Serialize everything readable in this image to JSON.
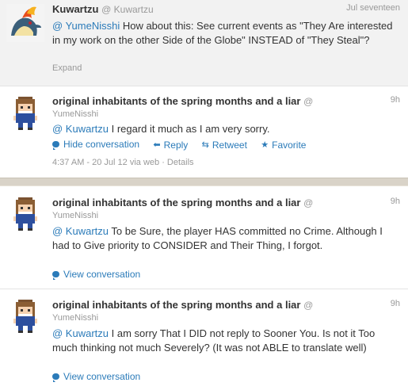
{
  "tweets": [
    {
      "name": "Kuwartzu",
      "handle": "@ Kuwartzu",
      "time": "Jul seventeen",
      "mention": "@ YumeNisshi",
      "text": " How about this: See current events as \"They Are interested in my work on the other Side of the Globe\" INSTEAD of \"They Steal\"?",
      "expand": "Expand"
    },
    {
      "name": "original inhabitants of the spring months and a liar",
      "handle_prefix": "@",
      "handle": "YumeNisshi",
      "time": "9h",
      "mention": "@ Kuwartzu",
      "text": " I regard it much as I am very sorry.",
      "actions": {
        "hide": "Hide conversation",
        "reply": "Reply",
        "retweet": "Retweet",
        "favorite": "Favorite"
      },
      "meta": "4:37 AM - 20 Jul 12 via web · Details"
    },
    {
      "name": "original inhabitants of the spring months and a liar",
      "handle_prefix": "@",
      "handle": "YumeNisshi",
      "time": "9h",
      "mention": "@ Kuwartzu",
      "text": " To be Sure, the player HAS committed no Crime. Although I had to Give priority to CONSIDER and Their Thing, I forgot.",
      "view": "View conversation"
    },
    {
      "name": "original inhabitants of the spring months and a liar",
      "handle_prefix": "@",
      "handle": "YumeNisshi",
      "time": "9h",
      "mention": "@ Kuwartzu",
      "text": " I am sorry That I DID not reply to Sooner You. Is not it Too much thinking not much Severely? (It was not ABLE to translate well)",
      "view": "View conversation"
    }
  ],
  "colors": {
    "link": "#2b7bb9",
    "muted": "#999999",
    "text": "#333333"
  },
  "icons": [
    "dragon-avatar-icon",
    "pixel-girl-avatar-icon",
    "conversation-bubble-icon",
    "reply-arrow-icon",
    "retweet-icon",
    "star-icon"
  ]
}
